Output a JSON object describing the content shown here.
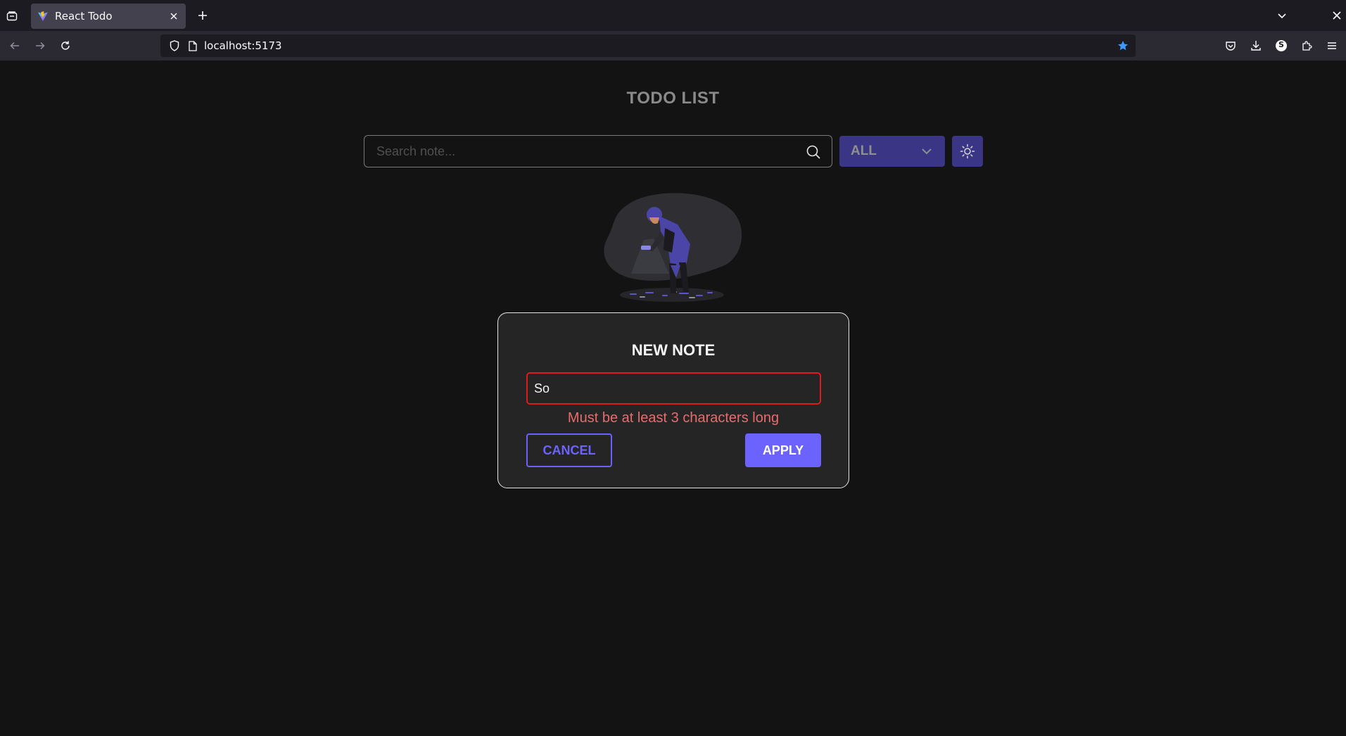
{
  "browser": {
    "tab_title": "React Todo",
    "url": "localhost:5173",
    "icons": {
      "tab_list": "tab-list-icon",
      "favicon": "vite-favicon",
      "tab_close": "close-icon",
      "new_tab": "plus-icon",
      "tabs_dropdown": "chevron-down-icon",
      "window_close": "close-icon",
      "back": "arrow-left-icon",
      "forward": "arrow-right-icon",
      "reload": "reload-icon",
      "tracking_protection": "shield-icon",
      "page_info": "page-icon",
      "bookmark": "star-icon",
      "pocket": "pocket-icon",
      "downloads": "download-icon",
      "account": "account-icon",
      "account_initial": "S",
      "extensions": "puzzle-icon",
      "menu": "hamburger-icon"
    }
  },
  "app": {
    "title": "TODO LIST",
    "search": {
      "placeholder": "Search note...",
      "value": ""
    },
    "filter": {
      "selected": "ALL"
    },
    "colors": {
      "accent": "#6c63ff",
      "accent_dim": "#3b3585",
      "error": "#e01b1b",
      "background": "#131313"
    }
  },
  "modal": {
    "title": "NEW NOTE",
    "input_value": "So",
    "error": "Must be at least 3 characters long",
    "cancel_label": "CANCEL",
    "apply_label": "APPLY"
  }
}
